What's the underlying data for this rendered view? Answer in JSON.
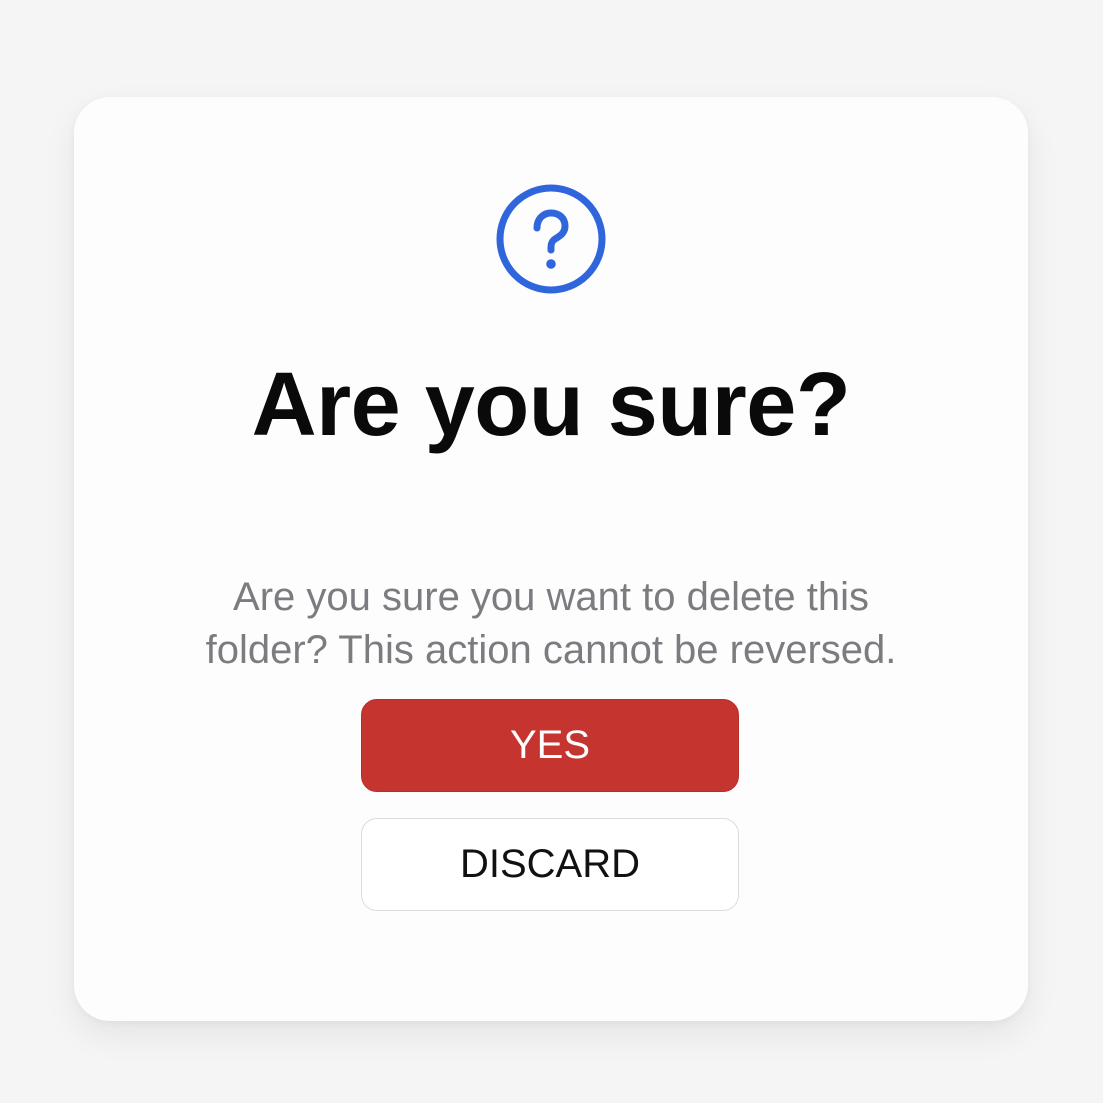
{
  "dialog": {
    "icon": "question-circle-icon",
    "title": "Are you sure?",
    "message": "Are you sure you want to delete this folder? This action cannot be reversed.",
    "yes_label": "YES",
    "discard_label": "DISCARD"
  },
  "colors": {
    "background": "#f6f5f5",
    "card": "#fdfdfe",
    "accent_icon": "#2f66dc",
    "danger": "#c5342f",
    "title": "#0a0a0a",
    "message": "#7c7c80"
  }
}
